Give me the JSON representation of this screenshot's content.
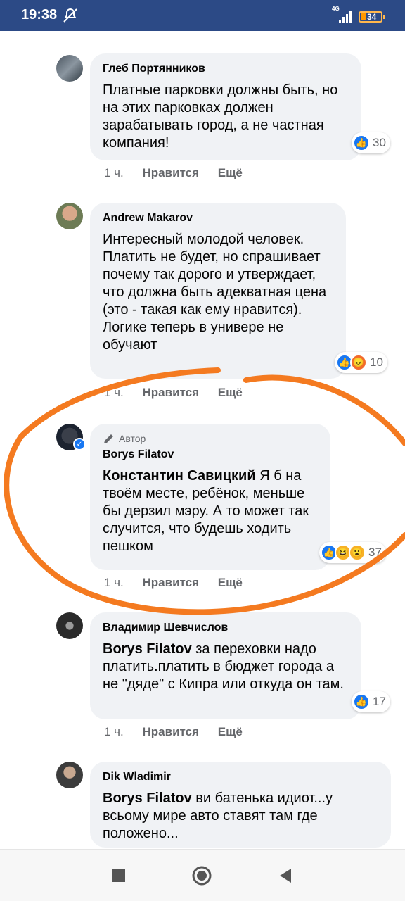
{
  "status": {
    "time": "19:38",
    "network": "4G",
    "battery": "34"
  },
  "comments": [
    {
      "author": "Глеб Портянников",
      "text": "Платные парковки должны быть, но на этих парковках должен зарабатывать город, а не частная компания!",
      "reaction_count": "30",
      "time": "1 ч.",
      "like_label": "Нравится",
      "more_label": "Ещё"
    },
    {
      "author": "Andrew Makarov",
      "text": "Интересный молодой человек. Платить не будет, но спрашивает почему так дорого и утверждает, что должна быть адекватная цена (это - такая как ему нравится). Логике теперь в универе не обучают",
      "reaction_count": "10",
      "time": "1 ч.",
      "like_label": "Нравится",
      "more_label": "Ещё"
    },
    {
      "badge": "Автор",
      "author": "Borys Filatov",
      "mention": "Константин Савицкий",
      "text": " Я б на твоём месте, ребёнок, меньше бы дерзил мэру. А то может так случится, что будешь ходить пешком",
      "reaction_count": "37",
      "time": "1 ч.",
      "like_label": "Нравится",
      "more_label": "Ещё"
    },
    {
      "author": "Владимир Шевчислов",
      "mention": "Borys Filatov",
      "text": " за переховки надо платить.платить в бюджет города а не \"дяде\" с Кипра или откуда он там.",
      "reaction_count": "17",
      "time": "1 ч.",
      "like_label": "Нравится",
      "more_label": "Ещё"
    },
    {
      "author": "Dik Wladimir",
      "mention": "Borys Filatov",
      "text": " ви батенька идиот...у всьому мире авто ставят там где положено..."
    }
  ],
  "colors": {
    "status_bar": "#2c4a86",
    "bubble": "#f0f2f5",
    "annotation": "#f47a20",
    "like": "#1877f2"
  },
  "icons": [
    "mute-icon",
    "signal-icon",
    "battery-icon",
    "like-reaction-icon",
    "angry-reaction-icon",
    "haha-reaction-icon",
    "wow-reaction-icon",
    "pencil-icon",
    "verified-icon",
    "square-nav-icon",
    "circle-nav-icon",
    "back-nav-icon"
  ]
}
